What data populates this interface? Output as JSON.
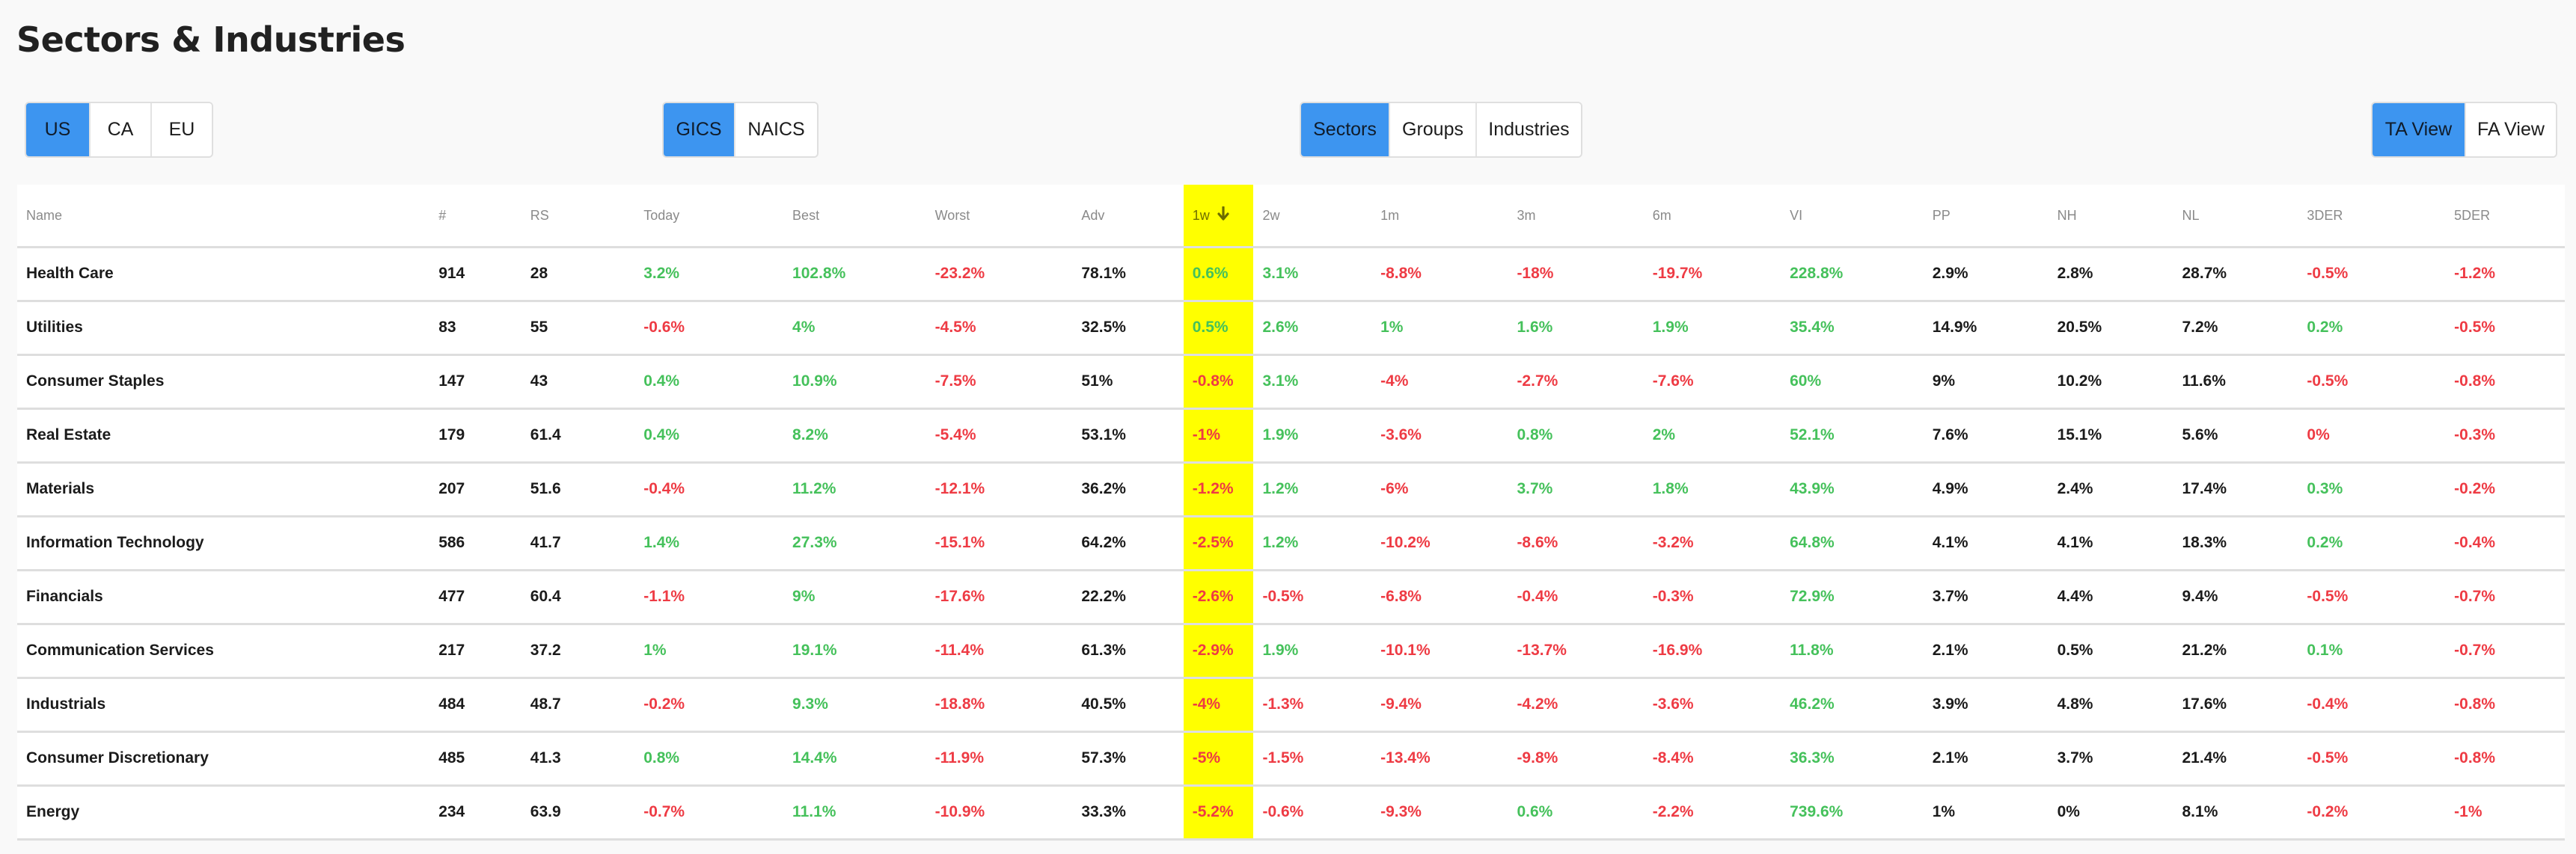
{
  "page": {
    "title": "Sectors & Industries"
  },
  "filters": {
    "region": {
      "options": [
        "US",
        "CA",
        "EU"
      ],
      "selected": "US"
    },
    "classification": {
      "options": [
        "GICS",
        "NAICS"
      ],
      "selected": "GICS"
    },
    "level": {
      "options": [
        "Sectors",
        "Groups",
        "Industries"
      ],
      "selected": "Sectors"
    },
    "view": {
      "options": [
        "TA View",
        "FA View"
      ],
      "selected": "TA View"
    }
  },
  "colors": {
    "accent": "#3d95f0",
    "positive": "#45c15b",
    "negative": "#ee3b44",
    "sort_highlight": "#ffff00"
  },
  "table": {
    "sorted_column": "1w",
    "sort_direction": "descending",
    "sort_icon": "arrow-down-icon",
    "columns": [
      "Name",
      "#",
      "RS",
      "Today",
      "Best",
      "Worst",
      "Adv",
      "1w",
      "2w",
      "1m",
      "3m",
      "6m",
      "VI",
      "PP",
      "NH",
      "NL",
      "3DER",
      "5DER"
    ],
    "rows": [
      [
        "Health Care",
        "914",
        "28",
        "3.2%",
        "102.8%",
        "-23.2%",
        "78.1%",
        "0.6%",
        "3.1%",
        "-8.8%",
        "-18%",
        "-19.7%",
        "228.8%",
        "2.9%",
        "2.8%",
        "28.7%",
        "-0.5%",
        "-1.2%"
      ],
      [
        "Utilities",
        "83",
        "55",
        "-0.6%",
        "4%",
        "-4.5%",
        "32.5%",
        "0.5%",
        "2.6%",
        "1%",
        "1.6%",
        "1.9%",
        "35.4%",
        "14.9%",
        "20.5%",
        "7.2%",
        "0.2%",
        "-0.5%"
      ],
      [
        "Consumer Staples",
        "147",
        "43",
        "0.4%",
        "10.9%",
        "-7.5%",
        "51%",
        "-0.8%",
        "3.1%",
        "-4%",
        "-2.7%",
        "-7.6%",
        "60%",
        "9%",
        "10.2%",
        "11.6%",
        "-0.5%",
        "-0.8%"
      ],
      [
        "Real Estate",
        "179",
        "61.4",
        "0.4%",
        "8.2%",
        "-5.4%",
        "53.1%",
        "-1%",
        "1.9%",
        "-3.6%",
        "0.8%",
        "2%",
        "52.1%",
        "7.6%",
        "15.1%",
        "5.6%",
        "0%",
        "-0.3%"
      ],
      [
        "Materials",
        "207",
        "51.6",
        "-0.4%",
        "11.2%",
        "-12.1%",
        "36.2%",
        "-1.2%",
        "1.2%",
        "-6%",
        "3.7%",
        "1.8%",
        "43.9%",
        "4.9%",
        "2.4%",
        "17.4%",
        "0.3%",
        "-0.2%"
      ],
      [
        "Information Technology",
        "586",
        "41.7",
        "1.4%",
        "27.3%",
        "-15.1%",
        "64.2%",
        "-2.5%",
        "1.2%",
        "-10.2%",
        "-8.6%",
        "-3.2%",
        "64.8%",
        "4.1%",
        "4.1%",
        "18.3%",
        "0.2%",
        "-0.4%"
      ],
      [
        "Financials",
        "477",
        "60.4",
        "-1.1%",
        "9%",
        "-17.6%",
        "22.2%",
        "-2.6%",
        "-0.5%",
        "-6.8%",
        "-0.4%",
        "-0.3%",
        "72.9%",
        "3.7%",
        "4.4%",
        "9.4%",
        "-0.5%",
        "-0.7%"
      ],
      [
        "Communication Services",
        "217",
        "37.2",
        "1%",
        "19.1%",
        "-11.4%",
        "61.3%",
        "-2.9%",
        "1.9%",
        "-10.1%",
        "-13.7%",
        "-16.9%",
        "11.8%",
        "2.1%",
        "0.5%",
        "21.2%",
        "0.1%",
        "-0.7%"
      ],
      [
        "Industrials",
        "484",
        "48.7",
        "-0.2%",
        "9.3%",
        "-18.8%",
        "40.5%",
        "-4%",
        "-1.3%",
        "-9.4%",
        "-4.2%",
        "-3.6%",
        "46.2%",
        "3.9%",
        "4.8%",
        "17.6%",
        "-0.4%",
        "-0.8%"
      ],
      [
        "Consumer Discretionary",
        "485",
        "41.3",
        "0.8%",
        "14.4%",
        "-11.9%",
        "57.3%",
        "-5%",
        "-1.5%",
        "-13.4%",
        "-9.8%",
        "-8.4%",
        "36.3%",
        "2.1%",
        "3.7%",
        "21.4%",
        "-0.5%",
        "-0.8%"
      ],
      [
        "Energy",
        "234",
        "63.9",
        "-0.7%",
        "11.1%",
        "-10.9%",
        "33.3%",
        "-5.2%",
        "-0.6%",
        "-9.3%",
        "0.6%",
        "-2.2%",
        "739.6%",
        "1%",
        "0%",
        "8.1%",
        "-0.2%",
        "-1%"
      ]
    ],
    "column_tone": {
      "Name": "neutral",
      "#": "neutral",
      "RS": "neutral",
      "Today": "signed",
      "Best": "signed",
      "Worst": "signed",
      "Adv": "neutral",
      "1w": "signed",
      "2w": "signed",
      "1m": "signed",
      "3m": "signed",
      "6m": "signed",
      "VI": "signed",
      "PP": "neutral",
      "NH": "neutral",
      "NL": "neutral",
      "3DER": "signed",
      "5DER": "signed"
    }
  }
}
